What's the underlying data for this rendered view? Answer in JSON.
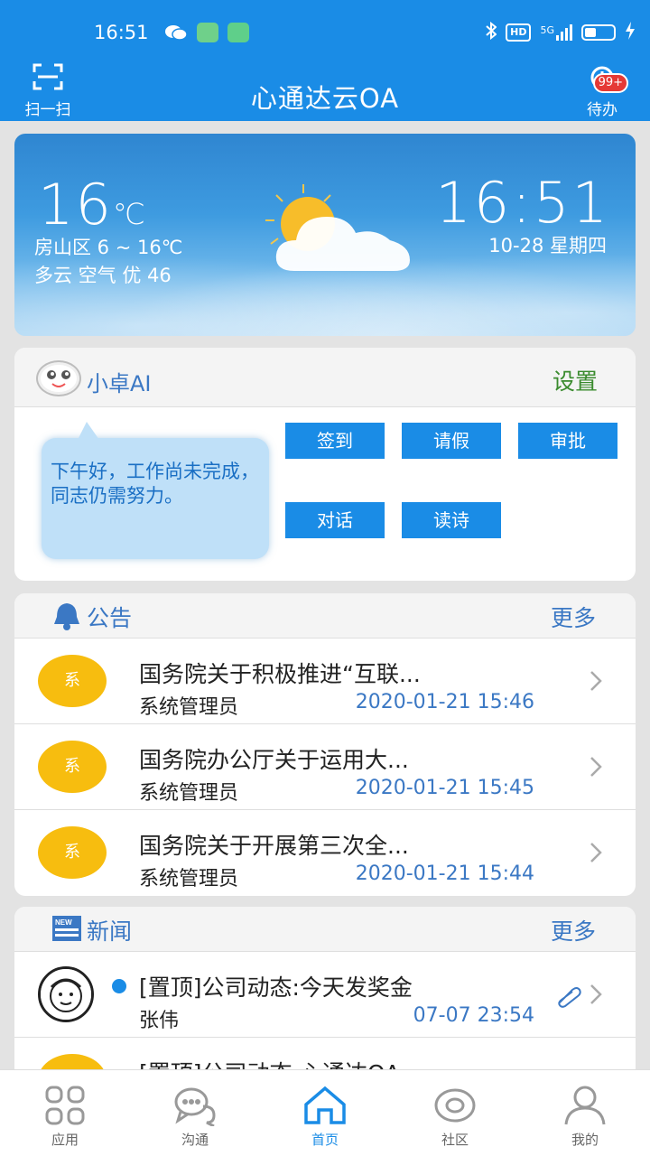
{
  "status_bar": {
    "time": "16:51",
    "network": "5G",
    "hd": "HD"
  },
  "header": {
    "scan_label": "扫一扫",
    "title": "心通达云OA",
    "todo_label": "待办",
    "todo_badge": "99+"
  },
  "weather": {
    "temperature": "16",
    "temp_unit": "℃",
    "location_range": "房山区 6 ~ 16℃",
    "condition_air": "多云 空气 优 46",
    "clock": "16:51",
    "date": "10-28 星期四",
    "icon": "partly-cloudy-icon"
  },
  "ai": {
    "title": "小卓AI",
    "settings": "设置",
    "message": "下午好，工作尚未完成，同志仍需努力。",
    "buttons": [
      "签到",
      "请假",
      "审批",
      "对话",
      "读诗"
    ]
  },
  "notice": {
    "title": "公告",
    "more": "更多",
    "items": [
      {
        "avatar": "系",
        "title": "国务院关于积极推进“互联...",
        "author": "系统管理员",
        "date": "2020-01-21 15:46"
      },
      {
        "avatar": "系",
        "title": "国务院办公厅关于运用大...",
        "author": "系统管理员",
        "date": "2020-01-21 15:45"
      },
      {
        "avatar": "系",
        "title": "国务院关于开展第三次全...",
        "author": "系统管理员",
        "date": "2020-01-21 15:44"
      }
    ]
  },
  "news": {
    "title": "新闻",
    "more": "更多",
    "items": [
      {
        "title": "[置顶]公司动态:今天发奖金",
        "author": "张伟",
        "date": "07-07 23:54"
      },
      {
        "title": "[置顶]公司动态:心通达OA"
      }
    ]
  },
  "bottom_nav": [
    {
      "label": "应用",
      "icon": "apps-icon"
    },
    {
      "label": "沟通",
      "icon": "chat-icon"
    },
    {
      "label": "首页",
      "icon": "home-icon"
    },
    {
      "label": "社区",
      "icon": "community-icon"
    },
    {
      "label": "我的",
      "icon": "profile-icon"
    }
  ],
  "colors": {
    "primary": "#1a8ce6",
    "accent_green": "#3a8b2e",
    "avatar_yellow": "#f7bd0f"
  }
}
